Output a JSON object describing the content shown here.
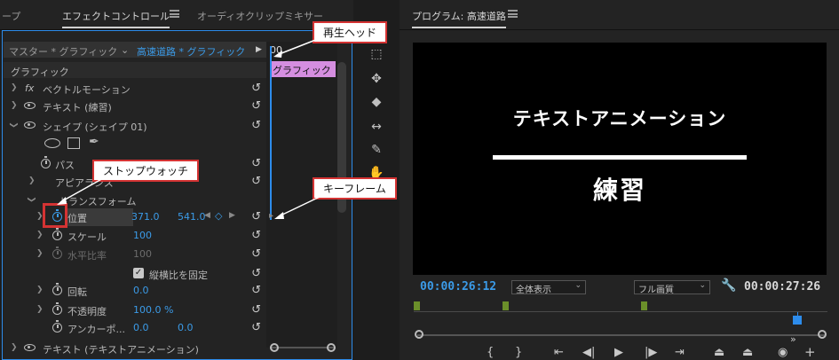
{
  "left_tabs": [
    "ープ",
    "エフェクトコントロール",
    "オーディオクリップミキサー"
  ],
  "source_bar": {
    "master": "マスター * グラフィック",
    "clip": "高速道路 * グラフィック"
  },
  "mini_timeline": {
    "start_label": "00",
    "clip_label": "グラフィック"
  },
  "section_header": "グラフィック",
  "rows": [
    {
      "label": "ベクトルモーション",
      "prefix": "fx"
    },
    {
      "label": "テキスト (練習)"
    },
    {
      "label": "シェイプ (シェイプ 01)"
    },
    {
      "label": "パス"
    },
    {
      "label": "アピアランス"
    },
    {
      "label": "トランスフォーム"
    },
    {
      "label": "位置",
      "v1": "371.0",
      "v2": "541.0"
    },
    {
      "label": "スケール",
      "v1": "100"
    },
    {
      "label": "水平比率",
      "v1": "100"
    },
    {
      "label": "縦横比を固定"
    },
    {
      "label": "回転",
      "v1": "0.0"
    },
    {
      "label": "不透明度",
      "v1": "100.0 %"
    },
    {
      "label": "アンカーポ...",
      "v1": "0.0",
      "v2": "0.0"
    },
    {
      "label": "テキスト (テキストアニメーション)"
    }
  ],
  "callouts": {
    "playhead": "再生ヘッド",
    "stopwatch": "ストップウォッチ",
    "keyframe": "キーフレーム"
  },
  "program": {
    "title": "プログラム: 高速道路",
    "screen_title": "テキストアニメーション",
    "screen_sub": "練習",
    "timecode_current": "00:00:26:12",
    "timecode_duration": "00:00:27:26",
    "zoom": "全体表示",
    "quality": "フル画質"
  },
  "colors": {
    "accent": "#2d8ceb",
    "value": "#3b9be8",
    "clip": "#d58ee0",
    "callout_border": "#d43333"
  }
}
